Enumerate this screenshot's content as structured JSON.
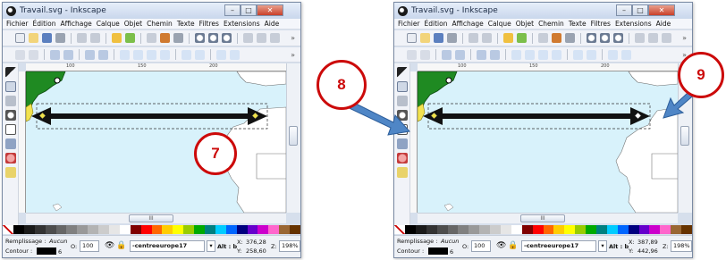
{
  "windows": [
    {
      "title": "Travail.svg - Inkscape",
      "menu": [
        "Fichier",
        "Édition",
        "Affichage",
        "Calque",
        "Objet",
        "Chemin",
        "Texte",
        "Filtres",
        "Extensions",
        "Aide"
      ],
      "ruler_labels": [
        "100",
        "150",
        "200"
      ],
      "hscroll_label": "III",
      "status": {
        "fill_label": "Remplissage :",
        "fill_value": "Aucun",
        "stroke_label": "Contour :",
        "stroke_width": "6",
        "opacity_label": "O:",
        "opacity_value": "100",
        "layer": "-centreeurope17",
        "alt_label": "Alt : b",
        "x_label": "X:",
        "x_value": "376,28",
        "y_label": "Y:",
        "y_value": "258,60",
        "zoom_label": "Z:",
        "zoom_value": "198%"
      },
      "arrow_handle": "end"
    },
    {
      "title": "Travail.svg - Inkscape",
      "menu": [
        "Fichier",
        "Édition",
        "Affichage",
        "Calque",
        "Objet",
        "Chemin",
        "Texte",
        "Filtres",
        "Extensions",
        "Aide"
      ],
      "ruler_labels": [
        "100",
        "150",
        "200"
      ],
      "hscroll_label": "III",
      "status": {
        "fill_label": "Remplissage :",
        "fill_value": "Aucun",
        "stroke_label": "Contour :",
        "stroke_width": "6",
        "opacity_label": "O:",
        "opacity_value": "100",
        "layer": "-centreeurope17",
        "alt_label": "Alt : b",
        "x_label": "X:",
        "x_value": "387,89",
        "y_label": "Y:",
        "y_value": "442,96",
        "zoom_label": "Z:",
        "zoom_value": "198%"
      },
      "arrow_handle": "end"
    }
  ],
  "markers": [
    "7",
    "8",
    "9"
  ],
  "colors": {
    "sea": "#d8f2fb",
    "land": "#ffffff",
    "marker_red": "#cc0a0a",
    "callout_blue": "#4f86c6",
    "arrow": "#111111"
  },
  "palette": [
    "#000000",
    "#1a1a1a",
    "#333333",
    "#4d4d4d",
    "#666666",
    "#808080",
    "#999999",
    "#b3b3b3",
    "#cccccc",
    "#e6e6e6",
    "#ffffff",
    "#800000",
    "#ff0000",
    "#ff6600",
    "#ffcc00",
    "#ffff00",
    "#99cc00",
    "#00aa00",
    "#008080",
    "#00ccff",
    "#0066ff",
    "#000080",
    "#6600cc",
    "#cc00cc",
    "#ff66cc",
    "#996633",
    "#663300"
  ]
}
